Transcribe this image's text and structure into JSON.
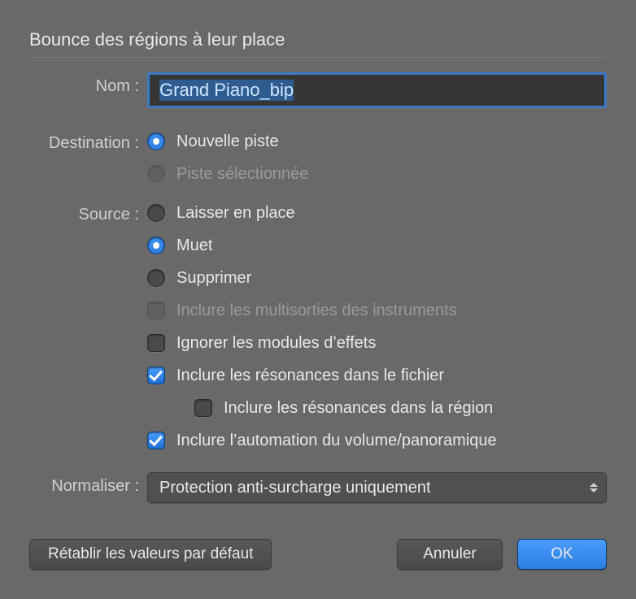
{
  "title": "Bounce des régions à leur place",
  "labels": {
    "name": "Nom :",
    "destination": "Destination :",
    "source": "Source :",
    "normalize": "Normaliser :"
  },
  "name_input": {
    "value": "Grand Piano_bip"
  },
  "destination": {
    "new_track": "Nouvelle piste",
    "selected_track": "Piste sélectionnée"
  },
  "source": {
    "leave_in_place": "Laisser en place",
    "mute": "Muet",
    "delete": "Supprimer",
    "include_multioutputs": "Inclure les multisorties des instruments",
    "ignore_effect_modules": "Ignorer les modules d’effets",
    "include_resonance_file": "Inclure les résonances dans le fichier",
    "include_resonance_region": "Inclure les résonances dans la région",
    "include_volume_pan_automation": "Inclure l’automation du volume/panoramique"
  },
  "normalize": {
    "value": "Protection anti-surcharge uniquement"
  },
  "buttons": {
    "restore_defaults": "Rétablir les valeurs par défaut",
    "cancel": "Annuler",
    "ok": "OK"
  }
}
